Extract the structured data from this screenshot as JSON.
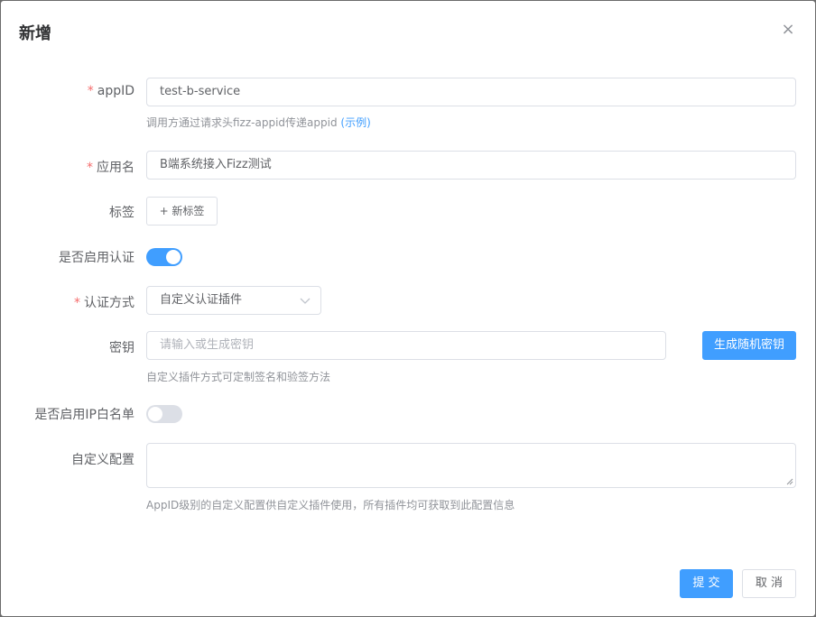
{
  "dialog": {
    "title": "新增",
    "close_label": "×"
  },
  "form": {
    "appid": {
      "label": "appID",
      "value": "test-b-service",
      "help_text": "调用方通过请求头fizz-appid传递appid",
      "help_link": "(示例)"
    },
    "app_name": {
      "label": "应用名",
      "value": "B端系统接入Fizz测试"
    },
    "tags": {
      "label": "标签",
      "add_button": "+ 新标签"
    },
    "enable_auth": {
      "label": "是否启用认证",
      "on": true
    },
    "auth_method": {
      "label": "认证方式",
      "selected": "自定义认证插件"
    },
    "secret": {
      "label": "密钥",
      "placeholder": "请输入或生成密钥",
      "generate_button": "生成随机密钥",
      "help_text": "自定义插件方式可定制签名和验签方法"
    },
    "ip_whitelist": {
      "label": "是否启用IP白名单",
      "on": false
    },
    "custom_config": {
      "label": "自定义配置",
      "value": "",
      "help_text": "AppID级别的自定义配置供自定义插件使用，所有插件均可获取到此配置信息"
    }
  },
  "footer": {
    "submit_label": "提 交",
    "cancel_label": "取 消"
  },
  "colors": {
    "primary": "#409eff",
    "required": "#f56c6c"
  }
}
